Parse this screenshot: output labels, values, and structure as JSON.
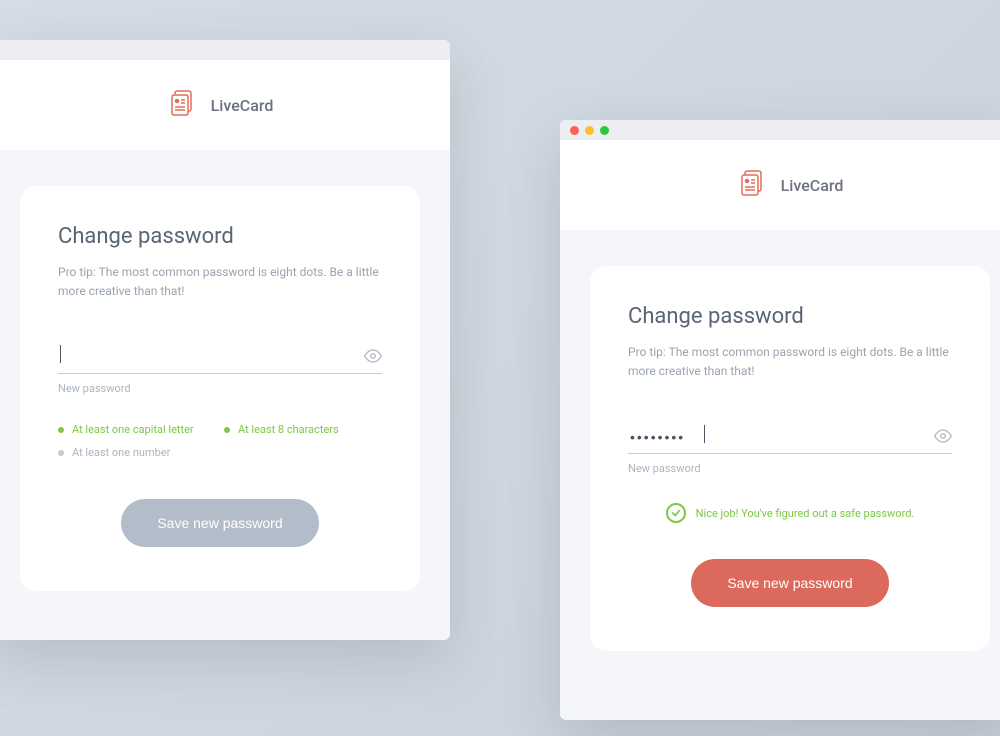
{
  "brand": {
    "name": "LiveCard"
  },
  "form": {
    "title": "Change password",
    "tip": "Pro tip: The most common password is eight dots. Be a little more creative than that!",
    "inputLabel": "New password",
    "submitLabel": "Save new password"
  },
  "left": {
    "passwordValue": "",
    "requirements": [
      {
        "label": "At least one capital letter",
        "met": true
      },
      {
        "label": "At least 8 characters",
        "met": true
      },
      {
        "label": "At least one number",
        "met": false
      }
    ]
  },
  "right": {
    "passwordValue": "••••••••",
    "successMessage": "Nice job! You've figured out a safe password."
  },
  "colors": {
    "accent": "#db6a5c",
    "success": "#7cc843",
    "muted": "#b3bdc9"
  }
}
